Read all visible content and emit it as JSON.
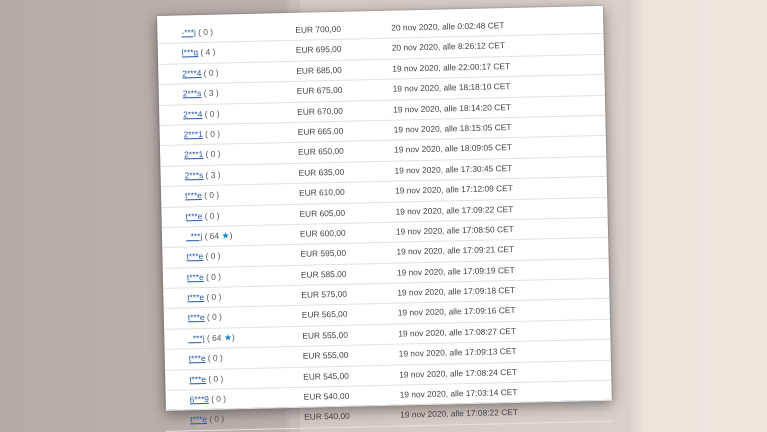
{
  "bids": [
    {
      "bidder": "-***j",
      "score": "( 0 )",
      "amount": "EUR 700,00",
      "time": "20 nov 2020, alle 0:02:48 CET"
    },
    {
      "bidder": "l***g",
      "score": "( 4 )",
      "amount": "EUR 695,00",
      "time": "20 nov 2020, alle 8:26:12 CET"
    },
    {
      "bidder": "2***4",
      "score": "( 0 )",
      "amount": "EUR 685,00",
      "time": "19 nov 2020, alle 22:00:17 CET"
    },
    {
      "bidder": "2***s",
      "score": "( 3 )",
      "amount": "EUR 675,00",
      "time": "19 nov 2020, alle 18:18:10 CET"
    },
    {
      "bidder": "2***4",
      "score": "( 0 )",
      "amount": "EUR 670,00",
      "time": "19 nov 2020, alle 18:14:20 CET"
    },
    {
      "bidder": "2***1",
      "score": "( 0 )",
      "amount": "EUR 665,00",
      "time": "19 nov 2020, alle 18:15:05 CET"
    },
    {
      "bidder": "2***1",
      "score": "( 0 )",
      "amount": "EUR 650,00",
      "time": "19 nov 2020, alle 18:09:05 CET"
    },
    {
      "bidder": "2***s",
      "score": "( 3 )",
      "amount": "EUR 635,00",
      "time": "19 nov 2020, alle 17:30:45 CET"
    },
    {
      "bidder": "t***e",
      "score": "( 0 )",
      "amount": "EUR 610,00",
      "time": "19 nov 2020, alle 17:12:09 CET"
    },
    {
      "bidder": "t***e",
      "score": "( 0 )",
      "amount": "EUR 605,00",
      "time": "19 nov 2020, alle 17:09:22 CET"
    },
    {
      "bidder": "_***j",
      "score": "( 64",
      "amount": "EUR 600,00",
      "time": "19 nov 2020, alle 17:08:50 CET",
      "star": true
    },
    {
      "bidder": "t***e",
      "score": "( 0 )",
      "amount": "EUR 595,00",
      "time": "19 nov 2020, alle 17:09:21 CET"
    },
    {
      "bidder": "t***e",
      "score": "( 0 )",
      "amount": "EUR 585,00",
      "time": "19 nov 2020, alle 17:09:19 CET"
    },
    {
      "bidder": "t***e",
      "score": "( 0 )",
      "amount": "EUR 575,00",
      "time": "19 nov 2020, alle 17:09:18 CET"
    },
    {
      "bidder": "t***e",
      "score": "( 0 )",
      "amount": "EUR 565,00",
      "time": "19 nov 2020, alle 17:09:16 CET"
    },
    {
      "bidder": "_***j",
      "score": "( 64",
      "amount": "EUR 555,00",
      "time": "19 nov 2020, alle 17:08:27 CET",
      "star": true
    },
    {
      "bidder": "t***e",
      "score": "( 0 )",
      "amount": "EUR 555,00",
      "time": "19 nov 2020, alle 17:09:13 CET"
    },
    {
      "bidder": "t***e",
      "score": "( 0 )",
      "amount": "EUR 545,00",
      "time": "19 nov 2020, alle 17:08:24 CET"
    },
    {
      "bidder": "6***9",
      "score": "( 0 )",
      "amount": "EUR 540,00",
      "time": "19 nov 2020, alle 17:03:14 CET"
    },
    {
      "bidder": "t***e",
      "score": "( 0 )",
      "amount": "EUR 540,00",
      "time": "19 nov 2020, alle 17:08:22 CET"
    }
  ],
  "star_suffix": ")",
  "colors": {
    "link": "#2458a8",
    "star": "#1d7fbf"
  },
  "icons": {
    "star": "star-icon"
  }
}
